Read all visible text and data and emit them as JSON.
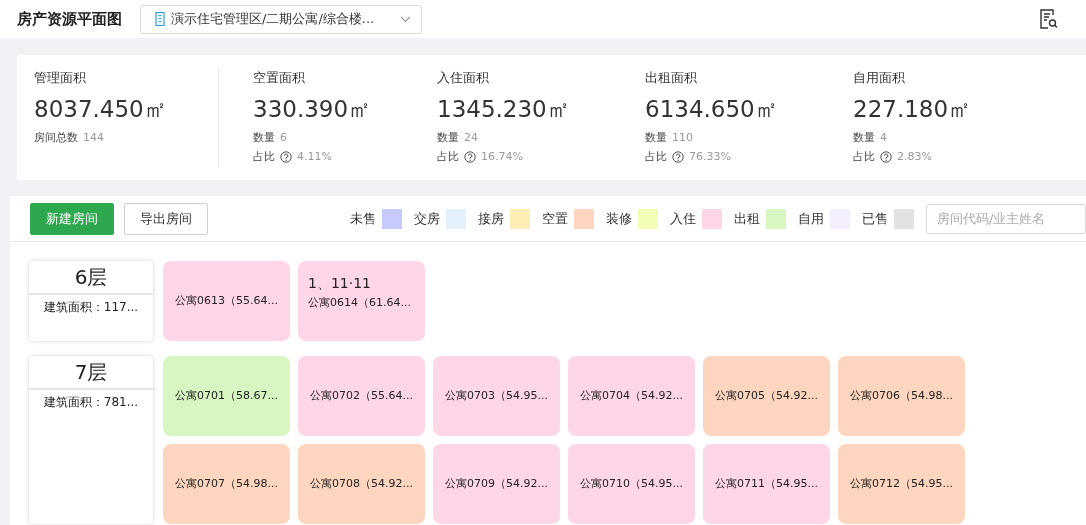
{
  "header": {
    "title": "房产资源平面图",
    "location": "演示住宅管理区/二期公寓/综合楼..."
  },
  "stats": [
    {
      "label": "管理面积",
      "value": "8037.450㎡",
      "lines": [
        {
          "label": "房间总数",
          "value": "144",
          "help": false
        }
      ]
    },
    {
      "label": "空置面积",
      "value": "330.390㎡",
      "lines": [
        {
          "label": "数量",
          "value": "6",
          "help": false
        },
        {
          "label": "占比",
          "value": "4.11%",
          "help": true
        }
      ]
    },
    {
      "label": "入住面积",
      "value": "1345.230㎡",
      "lines": [
        {
          "label": "数量",
          "value": "24",
          "help": false
        },
        {
          "label": "占比",
          "value": "16.74%",
          "help": true
        }
      ]
    },
    {
      "label": "出租面积",
      "value": "6134.650㎡",
      "lines": [
        {
          "label": "数量",
          "value": "110",
          "help": false
        },
        {
          "label": "占比",
          "value": "76.33%",
          "help": true
        }
      ]
    },
    {
      "label": "自用面积",
      "value": "227.180㎡",
      "lines": [
        {
          "label": "数量",
          "value": "4",
          "help": false
        },
        {
          "label": "占比",
          "value": "2.83%",
          "help": true
        }
      ]
    }
  ],
  "toolbar": {
    "buttons": [
      {
        "label": "新建房间",
        "kind": "primary"
      },
      {
        "label": "导出房间",
        "kind": "default"
      }
    ],
    "legend": [
      {
        "label": "未售",
        "color": "#c5ccfd"
      },
      {
        "label": "交房",
        "color": "#e3f1fd"
      },
      {
        "label": "接房",
        "color": "#fdeeb5"
      },
      {
        "label": "空置",
        "color": "#fed6bf"
      },
      {
        "label": "装修",
        "color": "#f3fdb8"
      },
      {
        "label": "入住",
        "color": "#fed6e8"
      },
      {
        "label": "出租",
        "color": "#d8f6c2"
      },
      {
        "label": "自用",
        "color": "#f5eefd"
      },
      {
        "label": "已售",
        "color": "#e2e2e2"
      }
    ],
    "search": {
      "placeholder": "房间代码/业主姓名"
    }
  },
  "floors": [
    {
      "name": "6层",
      "area": "建筑面积：117...",
      "rooms": [
        {
          "name": "公寓0613（55.64...",
          "color": "#fed6e8"
        },
        {
          "note": "1、11·11",
          "name": "公寓0614（61.64...",
          "color": "#fed6e8"
        }
      ]
    },
    {
      "name": "7层",
      "area": "建筑面积：781...",
      "rooms": [
        {
          "name": "公寓0701（58.67...",
          "color": "#d8f6c2"
        },
        {
          "name": "公寓0702（55.64...",
          "color": "#fed6e8"
        },
        {
          "name": "公寓0703（54.95...",
          "color": "#fed6e8"
        },
        {
          "name": "公寓0704（54.92...",
          "color": "#fed6e8"
        },
        {
          "name": "公寓0705（54.92...",
          "color": "#fed6bf"
        },
        {
          "name": "公寓0706（54.98...",
          "color": "#fed6bf"
        },
        {
          "name": "公寓0707（54.98...",
          "color": "#fed6bf"
        },
        {
          "name": "公寓0708（54.92...",
          "color": "#fed6bf"
        },
        {
          "name": "公寓0709（54.92...",
          "color": "#fed6e8"
        },
        {
          "name": "公寓0710（54.95...",
          "color": "#fed6e8"
        },
        {
          "name": "公寓0711（54.95...",
          "color": "#fed6e8"
        },
        {
          "name": "公寓0712（54.95...",
          "color": "#fed6bf"
        }
      ]
    }
  ]
}
